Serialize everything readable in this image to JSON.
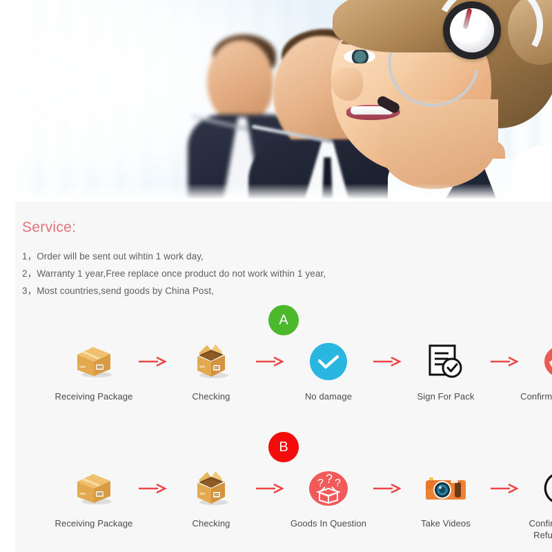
{
  "hero": {
    "alt": "call-center-agents-with-headsets-photo"
  },
  "service": {
    "title": "Service:",
    "lines": [
      "1，Order will be sent out wihtin 1 work day,",
      "2，Warranty 1 year,Free replace once product do not work within 1 year,",
      "3，Most countries,send goods by China Post,"
    ],
    "title_color": "#e0737b",
    "text_color": "#5e5e5e"
  },
  "flows": [
    {
      "badge": "A",
      "badge_color": "#4cb82b",
      "arrow_color": "#ef4444",
      "steps": [
        {
          "label": "Receiving Package",
          "icon": "closed-box-icon"
        },
        {
          "label": "Checking",
          "icon": "open-box-icon"
        },
        {
          "label": "No damage",
          "icon": "blue-check-circle-icon"
        },
        {
          "label": "Sign For Pack",
          "icon": "signed-document-icon"
        },
        {
          "label": "Confirm The Delivery",
          "icon": "handshake-icon"
        }
      ]
    },
    {
      "badge": "B",
      "badge_color": "#f40c0c",
      "arrow_color": "#ef4444",
      "steps": [
        {
          "label": "Receiving Package",
          "icon": "closed-box-icon"
        },
        {
          "label": "Checking",
          "icon": "open-box-icon"
        },
        {
          "label": "Goods In Question",
          "icon": "question-box-icon"
        },
        {
          "label": "Take Videos",
          "icon": "camera-icon"
        },
        {
          "label": "Confirm Problem Refund Money",
          "icon": "yen-refund-icon"
        }
      ]
    }
  ]
}
